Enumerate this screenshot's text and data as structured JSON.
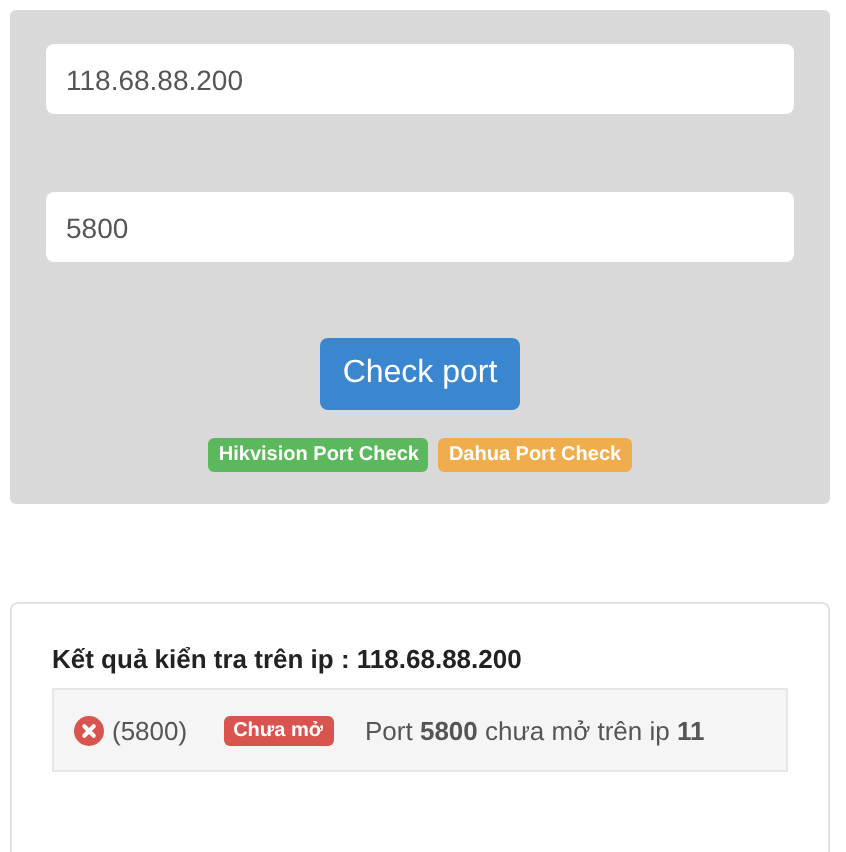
{
  "form": {
    "ip_field": {
      "value": "118.68.88.200"
    },
    "port_field": {
      "value": "5800"
    },
    "check_button": "Check port",
    "badges": [
      {
        "label": "Hikvision Port Check",
        "color": "#5cb85c"
      },
      {
        "label": "Dahua Port Check",
        "color": "#f0ad4e"
      }
    ]
  },
  "result": {
    "title": "Kết quả kiển tra trên ip : 118.68.88.200",
    "rows": [
      {
        "open": false,
        "port": "(5800)",
        "badge": "Chưa mở",
        "message": "Port **5800** chưa mở trên ip **11**"
      }
    ]
  }
}
